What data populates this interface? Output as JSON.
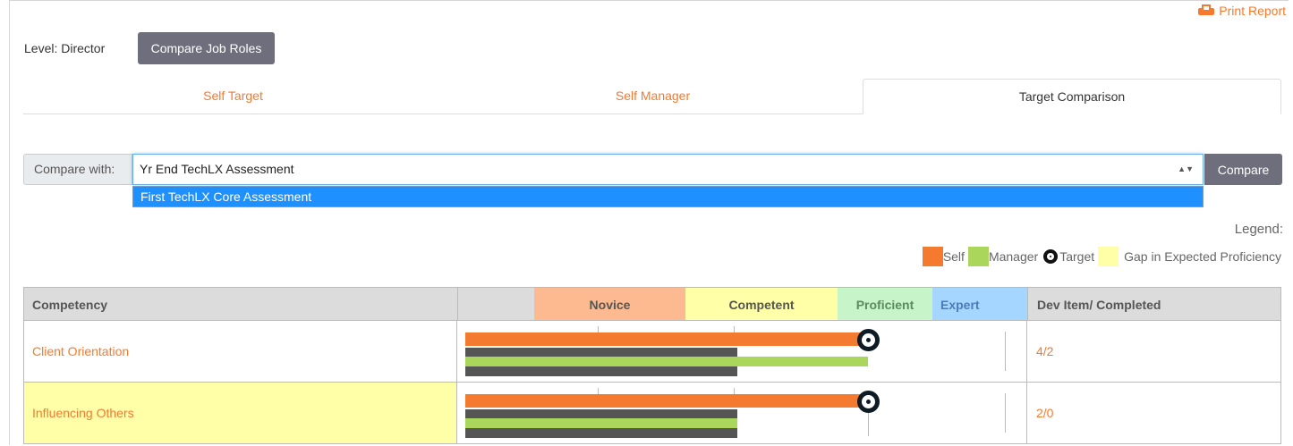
{
  "header": {
    "print_label": "Print Report",
    "level_label": "Level: Director",
    "compare_roles_label": "Compare Job Roles"
  },
  "tabs": [
    {
      "label": "Self Target",
      "active": false
    },
    {
      "label": "Self Manager",
      "active": false
    },
    {
      "label": "Target Comparison",
      "active": true
    }
  ],
  "compare": {
    "addon_label": "Compare with:",
    "selected_value": "Yr End TechLX Assessment",
    "button_label": "Compare",
    "dropdown_options": [
      "First TechLX Core Assessment"
    ]
  },
  "legend": {
    "title": "Legend:",
    "self": "Self",
    "manager": "Manager",
    "target": "Target",
    "gap": "Gap in Expected Proficiency"
  },
  "colors": {
    "accent": "#f47a30",
    "self": "#f47a30",
    "manager": "#a9d65b",
    "previous": "#555555",
    "gap": "#ffffa8",
    "novice": "#fdb98f",
    "competent": "#ffffa8",
    "proficient": "#c7f5c9",
    "expert": "#a5d6ff"
  },
  "table": {
    "headers": {
      "competency": "Competency",
      "novice": "Novice",
      "competent": "Competent",
      "proficient": "Proficient",
      "expert": "Expert",
      "dev": "Dev Item/ Completed"
    },
    "rows": [
      {
        "name": "Client Orientation",
        "dev": "4/2",
        "gap": false
      },
      {
        "name": "Influencing Others",
        "dev": "2/0",
        "gap": true
      }
    ]
  }
}
